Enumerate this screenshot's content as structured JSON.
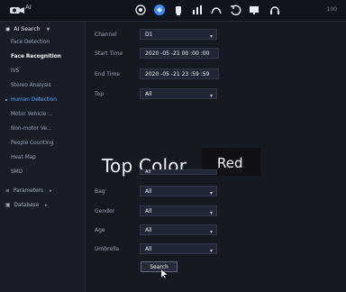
{
  "topbar": {
    "title": "AI",
    "status": "100"
  },
  "sidebar": {
    "ai_search": "AI Search",
    "items": [
      {
        "label": "Face Detection"
      },
      {
        "label": "Face Recognition"
      },
      {
        "label": "IVS"
      },
      {
        "label": "Stereo Analysis"
      },
      {
        "label": "Human Detection"
      },
      {
        "label": "Motor Vehicle ..."
      },
      {
        "label": "Non-motor Ve..."
      },
      {
        "label": "People Counting"
      },
      {
        "label": "Heat Map"
      },
      {
        "label": "SMD"
      }
    ],
    "parameters": "Parameters",
    "database": "Database"
  },
  "form": {
    "channel_label": "Channel",
    "channel_value": "D1",
    "start_label": "Start Time",
    "start_value": "2020 -05 -21   00 :00 :00",
    "end_label": "End Time",
    "end_value": "2020 -05 -21   23 :59 :59",
    "top_label": "Top",
    "top_value": "All",
    "top_color_label": "Top Color",
    "top_color_value": "Red",
    "hidden_value": "All",
    "bag_label": "Bag",
    "bag_value": "All",
    "gender_label": "Gender",
    "gender_value": "All",
    "age_label": "Age",
    "age_value": "All",
    "umbrella_label": "Umbrella",
    "umbrella_value": "All",
    "search_label": "Search"
  },
  "icons": {
    "logo": "camera-logo-icon",
    "toolbar": [
      "target-icon",
      "active-ai-icon",
      "person-icon",
      "chart-icon",
      "chart-icon",
      "loop-icon",
      "display-icon",
      "headset-icon"
    ],
    "cursor": "mouse-pointer-icon"
  },
  "colors": {
    "active": "#58a7ff",
    "background": "#151922",
    "sidebar": "#181d28",
    "input": "#202633"
  }
}
